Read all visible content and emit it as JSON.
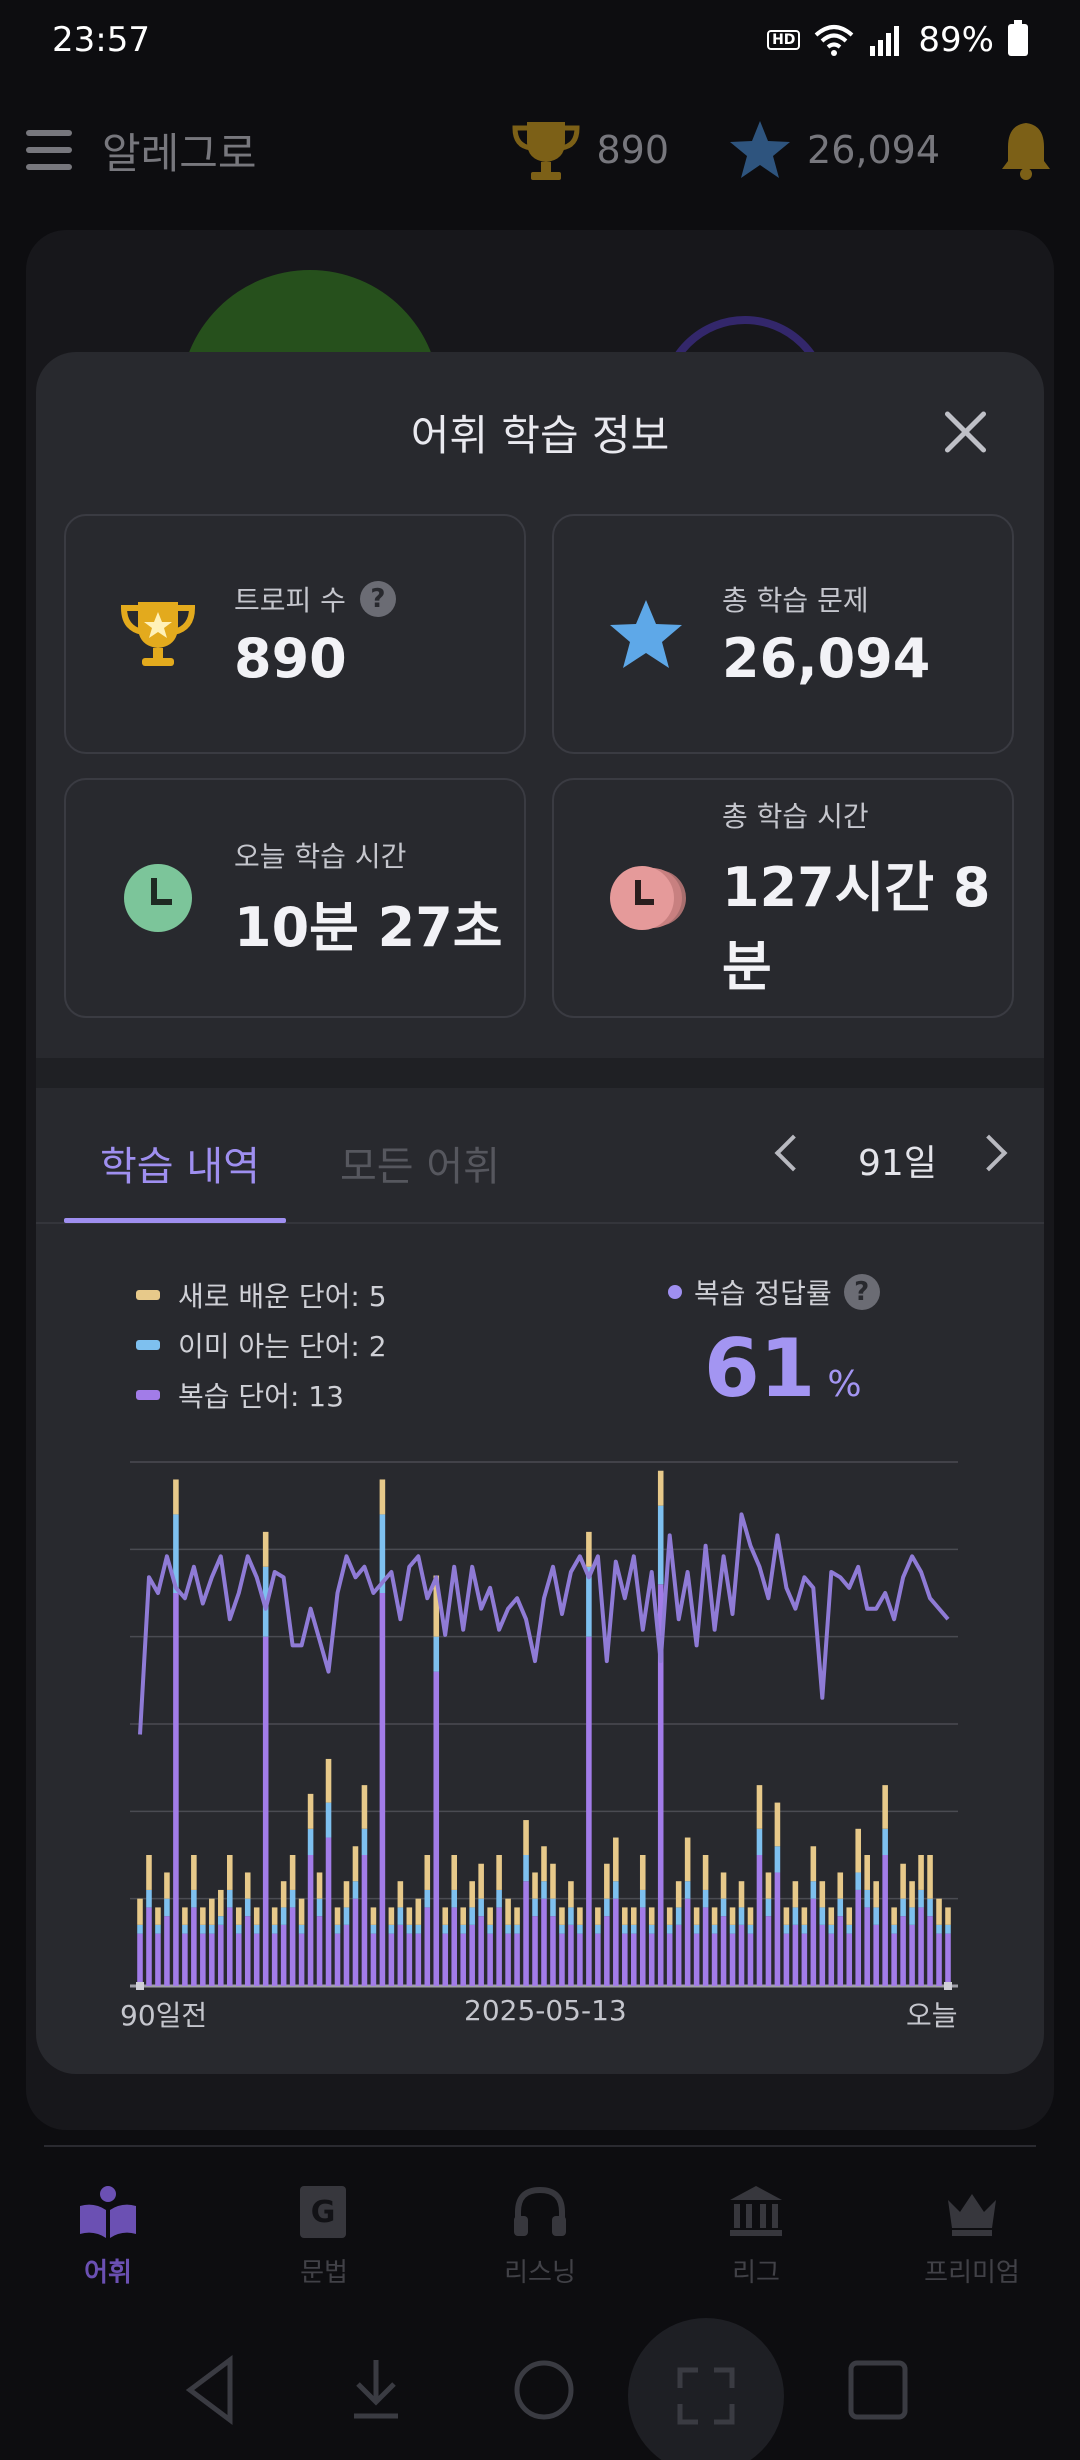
{
  "status": {
    "time": "23:57",
    "hd_label": "HD",
    "battery": "89%"
  },
  "appbar": {
    "title": "알레그로",
    "trophies": "890",
    "stars": "26,094"
  },
  "modal": {
    "title": "어휘 학습 정보",
    "cards": [
      {
        "label": "트로피 수",
        "value": "890",
        "icon": "trophy-icon",
        "has_help": true
      },
      {
        "label": "총 학습 문제",
        "value": "26,094",
        "icon": "star-icon",
        "has_help": false
      },
      {
        "label": "오늘 학습 시간",
        "value": "10분 27초",
        "icon": "clock-icon",
        "has_help": false
      },
      {
        "label": "총 학습 시간",
        "value": "127시간 8분",
        "icon": "clock-stack-icon",
        "has_help": false
      }
    ],
    "help_mark": "?",
    "tabs": {
      "active": "학습 내역",
      "inactive": "모든 어휘"
    },
    "range": "91일",
    "legend": [
      {
        "text": "새로 배운 단어: 5",
        "color": "#e7c98a"
      },
      {
        "text": "이미 아는 단어: 2",
        "color": "#7ec0ef"
      },
      {
        "text": "복습 단어: 13",
        "color": "#a27ce8"
      }
    ],
    "accuracy": {
      "label": "복습 정답률",
      "value": "61",
      "unit": "%"
    },
    "x_ticks": {
      "start": "90일전",
      "mid": "2025-05-13",
      "end": "오늘"
    }
  },
  "chart_data": {
    "type": "bar",
    "stacked": true,
    "days": 91,
    "x_tick_labels": [
      "90일전",
      "2025-05-13",
      "오늘"
    ],
    "colors": {
      "new": "#e7c98a",
      "known": "#7ec0ef",
      "review": "#a27ce8",
      "accuracy": "#8f7bd6"
    },
    "series": [
      {
        "name": "복습 단어",
        "values": [
          6,
          9,
          6,
          8,
          45,
          6,
          9,
          6,
          6,
          7,
          9,
          6,
          8,
          6,
          40,
          6,
          7,
          9,
          6,
          15,
          8,
          17,
          6,
          7,
          10,
          15,
          6,
          45,
          6,
          7,
          6,
          6,
          9,
          36,
          6,
          9,
          6,
          7,
          8,
          6,
          9,
          6,
          6,
          12,
          8,
          10,
          8,
          6,
          7,
          6,
          40,
          6,
          8,
          10,
          6,
          6,
          9,
          6,
          46,
          6,
          7,
          10,
          6,
          9,
          6,
          8,
          6,
          7,
          6,
          15,
          8,
          13,
          6,
          7,
          6,
          10,
          7,
          6,
          8,
          6,
          11,
          9,
          7,
          15,
          6,
          8,
          7,
          9,
          8,
          6,
          6
        ]
      },
      {
        "name": "이미 아는 단어",
        "values": [
          1,
          2,
          1,
          2,
          9,
          1,
          2,
          1,
          1,
          1,
          2,
          1,
          2,
          1,
          8,
          1,
          2,
          2,
          1,
          3,
          2,
          4,
          1,
          2,
          2,
          3,
          1,
          9,
          1,
          2,
          1,
          1,
          2,
          4,
          1,
          2,
          1,
          2,
          2,
          1,
          2,
          1,
          1,
          3,
          2,
          2,
          2,
          1,
          2,
          1,
          8,
          1,
          2,
          2,
          1,
          1,
          2,
          1,
          9,
          1,
          2,
          2,
          1,
          2,
          1,
          2,
          1,
          2,
          1,
          3,
          2,
          3,
          1,
          2,
          1,
          2,
          2,
          1,
          2,
          1,
          2,
          2,
          2,
          3,
          1,
          2,
          2,
          2,
          2,
          1,
          1
        ]
      },
      {
        "name": "새로 배운 단어",
        "values": [
          3,
          4,
          2,
          3,
          4,
          2,
          4,
          2,
          3,
          3,
          4,
          2,
          3,
          2,
          4,
          2,
          3,
          4,
          3,
          4,
          3,
          5,
          2,
          3,
          4,
          5,
          2,
          4,
          2,
          3,
          2,
          3,
          4,
          7,
          2,
          4,
          2,
          3,
          4,
          2,
          4,
          3,
          2,
          4,
          3,
          4,
          4,
          2,
          3,
          2,
          4,
          2,
          4,
          5,
          2,
          2,
          4,
          2,
          4,
          2,
          3,
          5,
          2,
          4,
          2,
          3,
          2,
          3,
          2,
          5,
          3,
          5,
          2,
          3,
          2,
          4,
          3,
          2,
          3,
          2,
          5,
          4,
          3,
          5,
          2,
          4,
          3,
          4,
          5,
          3,
          2
        ]
      }
    ],
    "accuracy_series": {
      "name": "복습 정답률",
      "values": [
        48,
        78,
        75,
        82,
        76,
        74,
        80,
        73,
        78,
        82,
        70,
        75,
        82,
        78,
        72,
        79,
        78,
        65,
        65,
        72,
        66,
        60,
        75,
        82,
        78,
        80,
        75,
        77,
        79,
        70,
        80,
        82,
        74,
        78,
        67,
        80,
        68,
        80,
        72,
        76,
        68,
        72,
        74,
        70,
        62,
        74,
        80,
        71,
        79,
        82,
        78,
        82,
        62,
        81,
        74,
        82,
        68,
        79,
        62,
        86,
        70,
        79,
        65,
        84,
        68,
        82,
        71,
        90,
        84,
        80,
        74,
        86,
        76,
        72,
        78,
        76,
        55,
        79,
        78,
        76,
        80,
        72,
        72,
        75,
        70,
        78,
        82,
        79,
        74,
        72,
        70
      ]
    },
    "ylim": [
      0,
      60
    ],
    "grid": true
  }
}
